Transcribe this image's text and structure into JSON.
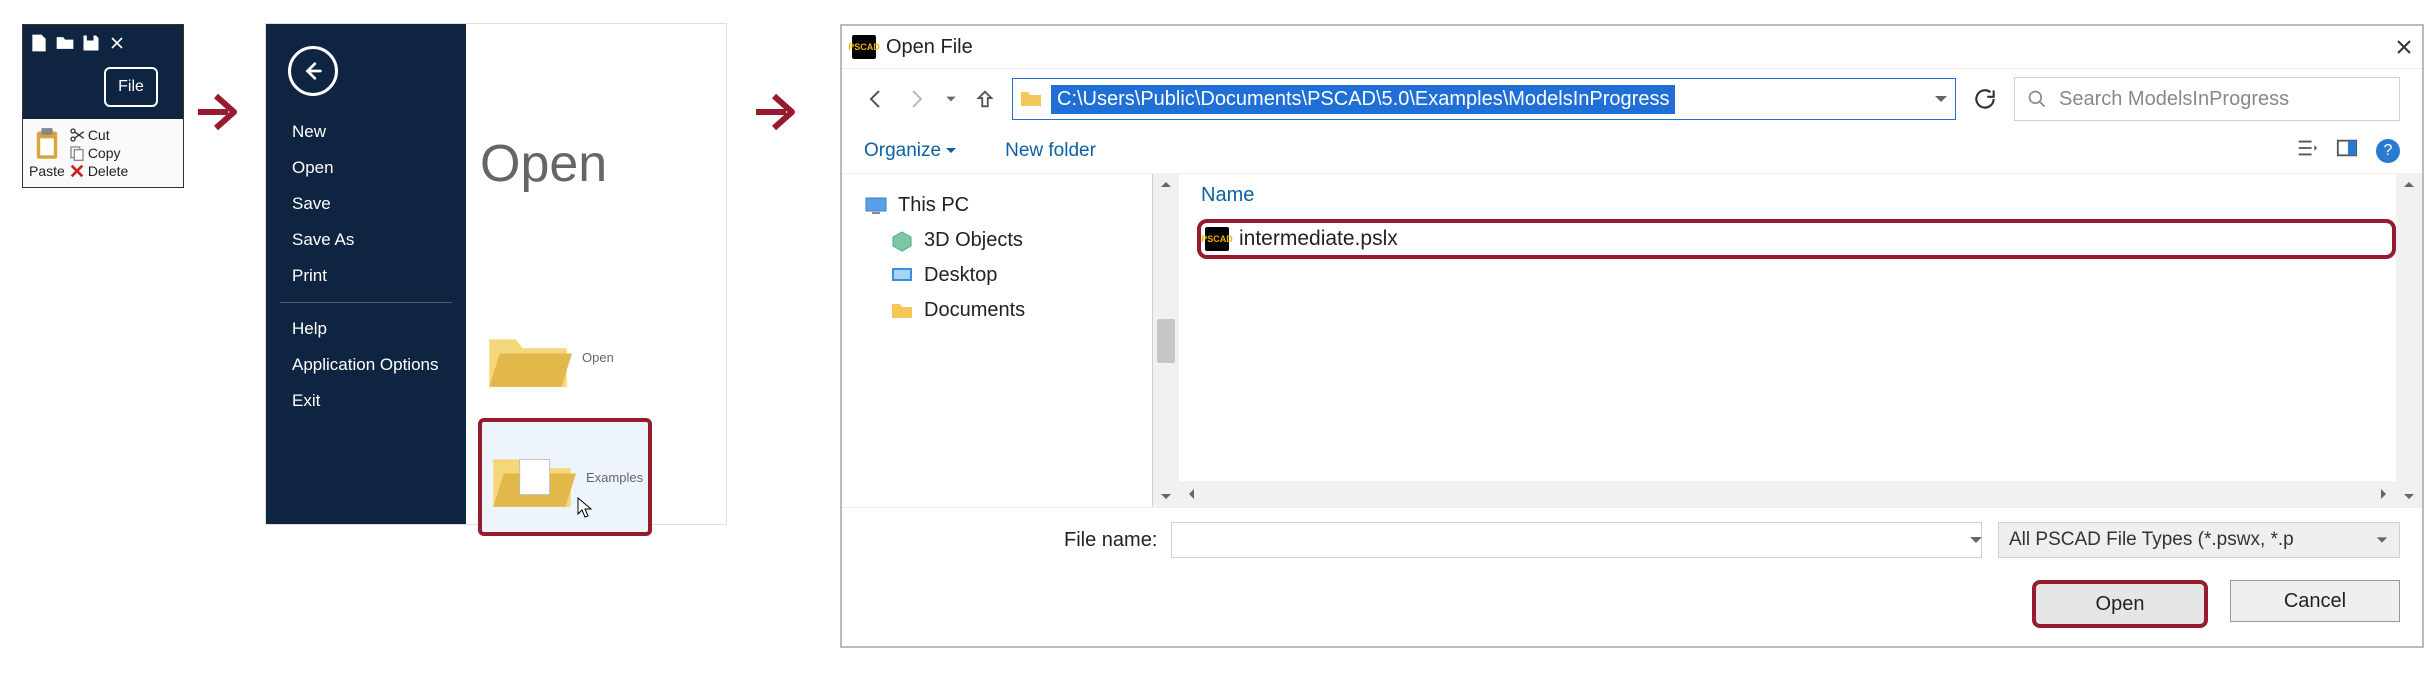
{
  "panel1": {
    "file_tab": "File",
    "paste": "Paste",
    "cut": "Cut",
    "copy": "Copy",
    "delete": "Delete"
  },
  "backstage": {
    "title": "Open",
    "items": [
      "New",
      "Open",
      "Save",
      "Save As",
      "Print",
      "Help",
      "Application Options",
      "Exit"
    ],
    "tile_open": "Open",
    "tile_examples": "Examples"
  },
  "dialog": {
    "title": "Open File",
    "path": "C:\\Users\\Public\\Documents\\PSCAD\\5.0\\Examples\\ModelsInProgress",
    "search_placeholder": "Search ModelsInProgress",
    "organize": "Organize",
    "new_folder": "New folder",
    "colName": "Name",
    "nav": {
      "this_pc": "This PC",
      "threeD": "3D Objects",
      "desktop": "Desktop",
      "documents": "Documents"
    },
    "file": "intermediate.pslx",
    "fn_label": "File name:",
    "type_filter": "All PSCAD File Types (*.pswx, *.p",
    "open": "Open",
    "cancel": "Cancel",
    "help": "?"
  }
}
